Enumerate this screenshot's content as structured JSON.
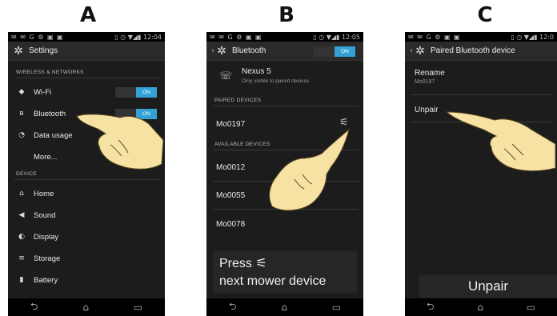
{
  "panels": [
    {
      "letter": "A"
    },
    {
      "letter": "B"
    },
    {
      "letter": "C"
    }
  ],
  "status": {
    "left_icons": "✉ ✉ G ⚙ ▣ ▣",
    "a_time": "12:04",
    "b_time": "12:05",
    "c_time": "12:0"
  },
  "a": {
    "title": "Settings",
    "section_wireless": "WIRELESS & NETWORKS",
    "wifi": "Wi-Fi",
    "wifi_toggle": "ON",
    "bluetooth": "Bluetooth",
    "bluetooth_toggle": "ON",
    "data_usage": "Data usage",
    "more": "More...",
    "section_device": "DEVICE",
    "home": "Home",
    "sound": "Sound",
    "display": "Display",
    "storage": "Storage",
    "battery": "Battery"
  },
  "b": {
    "title": "Bluetooth",
    "toggle": "ON",
    "device_name": "Nexus 5",
    "device_sub": "Only visible to paired devices",
    "section_paired": "PAIRED DEVICES",
    "paired": [
      "Mo0197"
    ],
    "section_available": "AVAILABLE DEVICES",
    "available": [
      "Mo0012",
      "Mo0055",
      "Mo0078"
    ],
    "caption_line1": "Press",
    "caption_line2": "next mower device"
  },
  "c": {
    "title": "Paired Bluetooth device",
    "rename": "Rename",
    "rename_sub": "Mo0197",
    "unpair": "Unpair",
    "caption": "Unpair"
  }
}
